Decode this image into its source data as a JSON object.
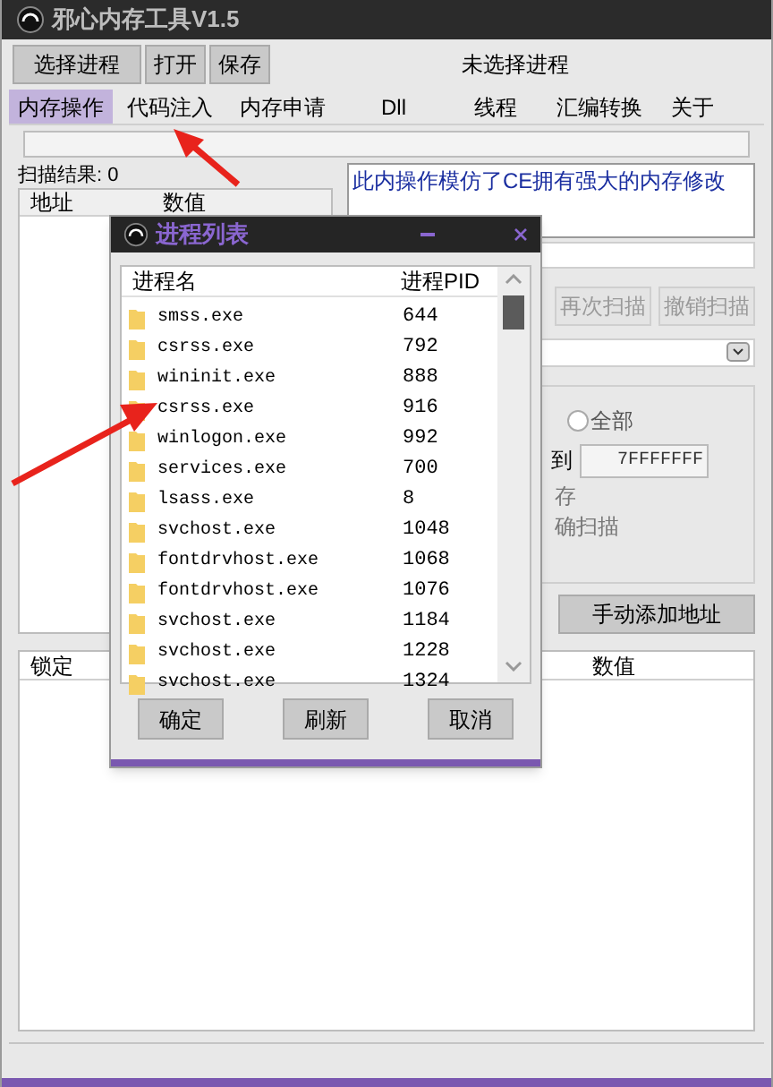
{
  "window": {
    "title": "邪心内存工具V1.5"
  },
  "toolbar": {
    "buttons": [
      "选择进程",
      "打开",
      "保存"
    ],
    "process_label": "未选择进程"
  },
  "tabs": [
    {
      "label": "内存操作",
      "selected": true
    },
    {
      "label": "代码注入",
      "selected": false
    },
    {
      "label": "内存申请",
      "selected": false
    },
    {
      "label": "Dll",
      "selected": false
    },
    {
      "label": "线程",
      "selected": false
    },
    {
      "label": "汇编转换",
      "selected": false
    },
    {
      "label": "关于",
      "selected": false
    }
  ],
  "scan_results": {
    "label": "扫描结果: 0",
    "columns": [
      "地址",
      "数值"
    ]
  },
  "description": "此内操作模仿了CE拥有强大的内存修改",
  "scan_buttons": [
    {
      "label": "再次扫描",
      "disabled": true
    },
    {
      "label": "撤销扫描",
      "disabled": true
    }
  ],
  "range": {
    "radio": {
      "label": "全部",
      "selected": false
    },
    "to_label": "到",
    "end_value": "7FFFFFFF"
  },
  "options": [
    "存",
    "确扫描"
  ],
  "add_address_button": "手动添加地址",
  "address_list": {
    "columns": [
      "锁定",
      "数值"
    ]
  },
  "dialog": {
    "title": "进程列表",
    "columns": [
      "进程名",
      "进程PID"
    ],
    "rows": [
      {
        "name": "smss.exe",
        "pid": "644"
      },
      {
        "name": "csrss.exe",
        "pid": "792"
      },
      {
        "name": "wininit.exe",
        "pid": "888"
      },
      {
        "name": "csrss.exe",
        "pid": "916"
      },
      {
        "name": "winlogon.exe",
        "pid": "992"
      },
      {
        "name": "services.exe",
        "pid": "700"
      },
      {
        "name": "lsass.exe",
        "pid": "8"
      },
      {
        "name": "svchost.exe",
        "pid": "1048"
      },
      {
        "name": "fontdrvhost.exe",
        "pid": "1068"
      },
      {
        "name": "fontdrvhost.exe",
        "pid": "1076"
      },
      {
        "name": "svchost.exe",
        "pid": "1184"
      },
      {
        "name": "svchost.exe",
        "pid": "1228"
      },
      {
        "name": "svchost.exe",
        "pid": "1324"
      }
    ],
    "buttons": [
      "确定",
      "刷新",
      "取消"
    ]
  }
}
